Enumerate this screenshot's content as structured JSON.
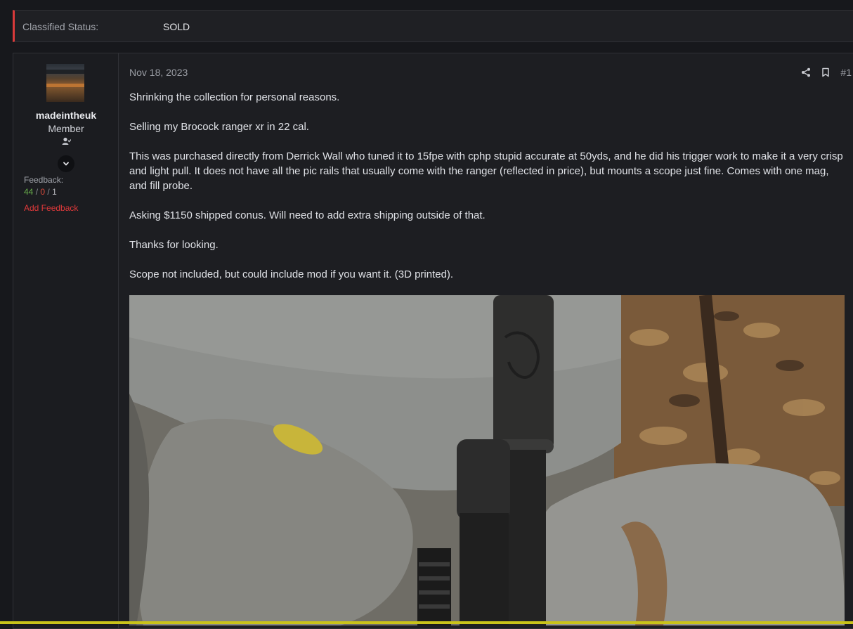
{
  "classified": {
    "label": "Classified Status:",
    "value": "SOLD"
  },
  "user": {
    "name": "madeintheuk",
    "title": "Member",
    "feedback_label": "Feedback:",
    "feedback_positive": "44",
    "feedback_neutral": "0",
    "feedback_negative": "1",
    "feedback_separator": "/",
    "add_feedback": "Add Feedback"
  },
  "post": {
    "date": "Nov 18, 2023",
    "number": "#1",
    "paragraphs": [
      "Shrinking the collection for personal reasons.",
      "Selling my Brocock ranger xr in 22 cal.",
      "This was purchased directly from Derrick Wall who tuned it to 15fpe with cphp stupid accurate at 50yds, and he did his trigger work to make it a very crisp and light pull. It does not have all the pic rails that usually come with the ranger (reflected in price), but mounts a scope just fine. Comes with one mag, and fill probe.",
      "Asking $1150 shipped conus. Will need to add extra shipping outside of that.",
      "Thanks for looking.",
      "Scope not included, but could include mod if you want it. (3D printed)."
    ]
  },
  "icons": {
    "share": "share-icon",
    "bookmark": "bookmark-icon",
    "user_banner": "user-icon",
    "expand": "chevron-down-icon"
  },
  "colors": {
    "status_accent": "#d93a3a",
    "feedback_positive": "#6ab04c",
    "feedback_negative": "#d94a3a",
    "add_feedback": "#e0393a"
  }
}
